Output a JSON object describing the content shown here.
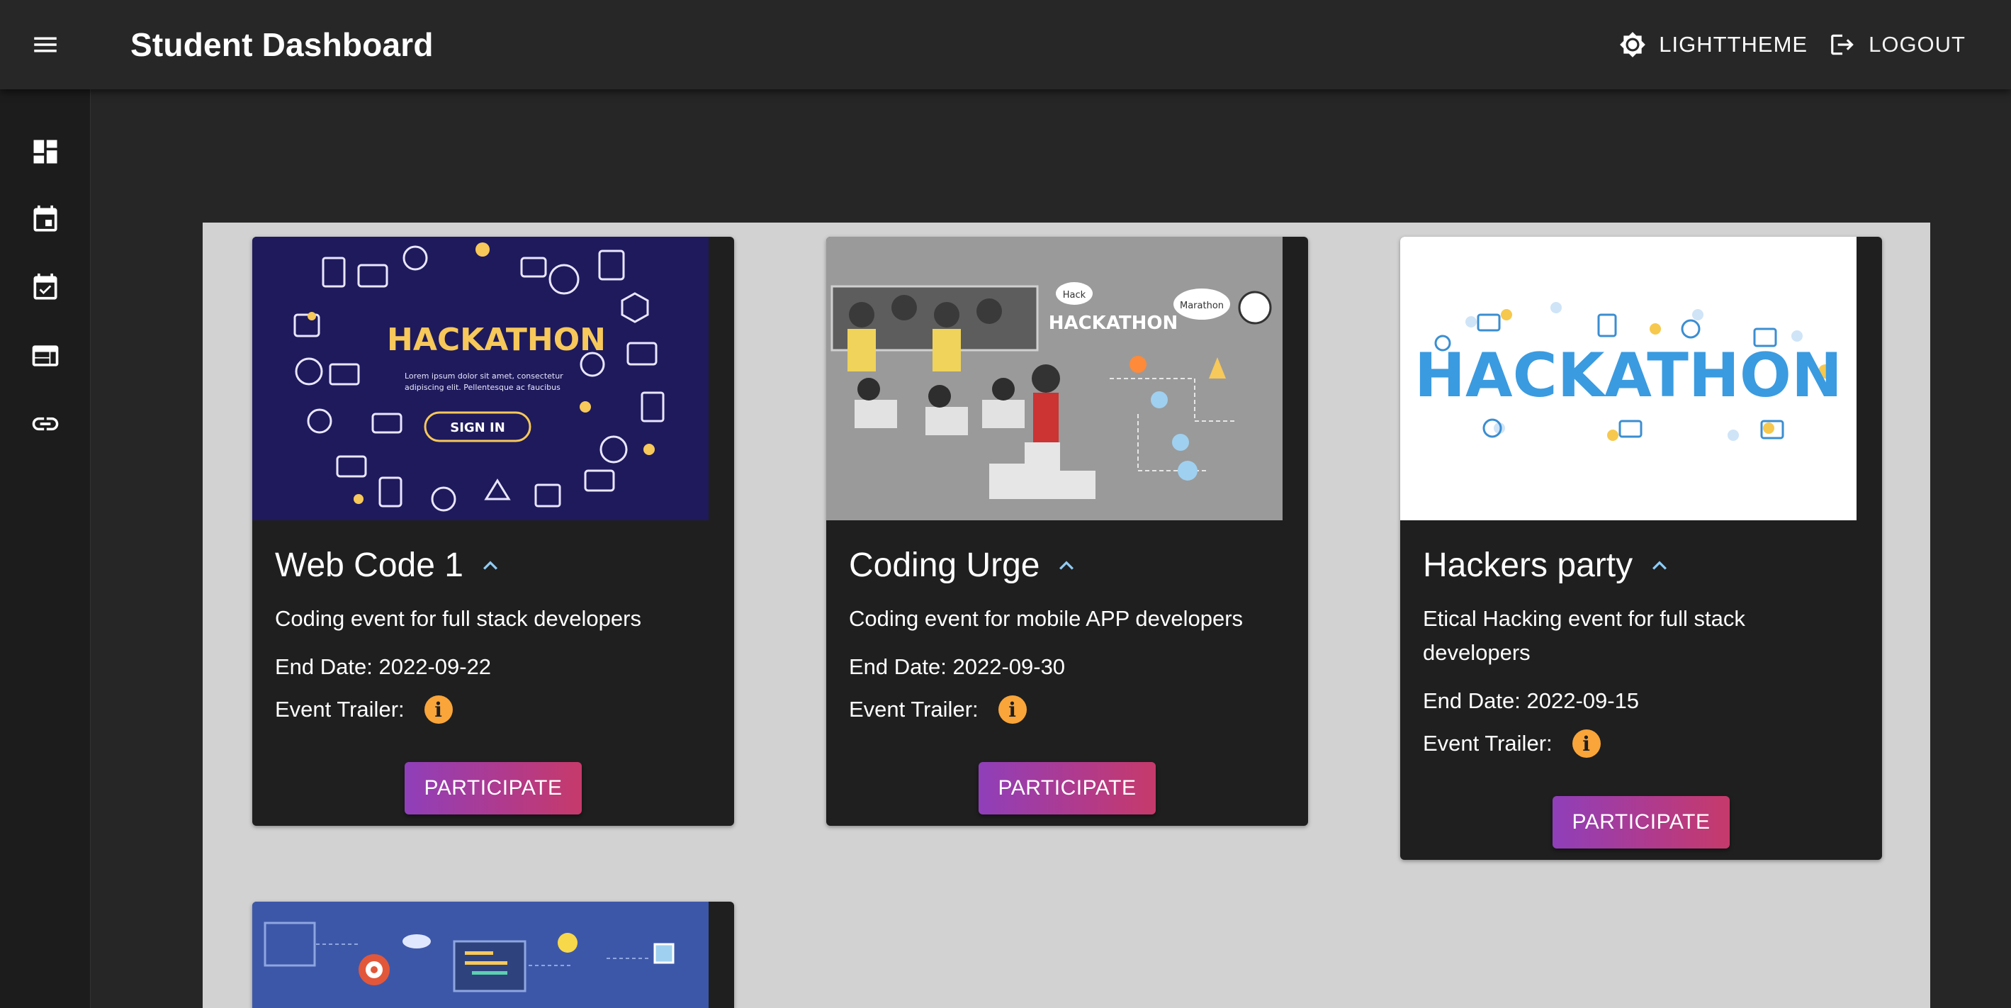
{
  "header": {
    "title": "Student Dashboard",
    "theme_label": "LIGHTTHEME",
    "logout_label": "LOGOUT"
  },
  "drawer": {
    "items": [
      {
        "icon": "dashboard-icon"
      },
      {
        "icon": "calendar-event-icon"
      },
      {
        "icon": "calendar-check-icon"
      },
      {
        "icon": "web-layout-icon"
      },
      {
        "icon": "link-icon"
      }
    ]
  },
  "cards": [
    {
      "title": "Web Code 1",
      "description": "Coding event for full stack developers",
      "end_date": "End Date: 2022-09-22",
      "trailer_label": "Event Trailer:",
      "button": "PARTICIPATE",
      "image_text": "HACKATHON",
      "image_sub": "Lorem ipsum dolor sit amet, consectetur adipiscing elit. Pellentesque ac faucibus",
      "image_button": "SIGN IN"
    },
    {
      "title": "Coding Urge",
      "description": "Coding event for mobile APP developers",
      "end_date": "End Date: 2022-09-30",
      "trailer_label": "Event Trailer:",
      "button": "PARTICIPATE",
      "image_text": "HACKATHON",
      "image_bubble1": "Hack",
      "image_bubble2": "Marathon"
    },
    {
      "title": "Hackers party",
      "description": "Etical Hacking event for full stack developers",
      "end_date": "End Date: 2022-09-15",
      "trailer_label": "Event Trailer:",
      "button": "PARTICIPATE",
      "image_text": "HACKATHON"
    }
  ],
  "colors": {
    "accent_info": "#f9a53a",
    "button_gradient_start": "#8f3fba",
    "button_gradient_end": "#c63a6a",
    "expand_icon": "#8ecbf5"
  }
}
